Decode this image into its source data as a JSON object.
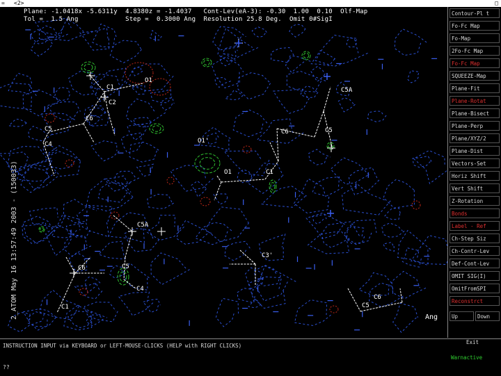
{
  "window": {
    "title_left": "=",
    "title": "<2>",
    "title_right": "□"
  },
  "header": {
    "line1": "Plane: -1.0418x -5.6311y  4.8380z = -1.4037   Cont-Lev(eA-3): -0.30  1.00  0.10  Olf-Map",
    "line2": "Tol =  1.5 Ang            Step =  0.3000 Ang  Resolution 25.8 Deg.  Omit 0#SigI"
  },
  "side_label": "2_ATOM  May 16 13:57:49 2003  -  (150033)",
  "axis_unit": "Ang",
  "colors": {
    "contour_blue": "#2a4fd0",
    "contour_green": "#30c030",
    "contour_red": "#c02818",
    "bond": "#ffffff"
  },
  "atoms": [
    {
      "label": "C1"
    },
    {
      "label": "O1"
    },
    {
      "label": "C2"
    },
    {
      "label": "C6"
    },
    {
      "label": "C5"
    },
    {
      "label": "C4"
    },
    {
      "label": "O1'"
    },
    {
      "label": "O1"
    },
    {
      "label": "C1"
    },
    {
      "label": "C6"
    },
    {
      "label": "C5"
    },
    {
      "label": "C5A"
    },
    {
      "label": "C5A"
    },
    {
      "label": "C6"
    },
    {
      "label": "C5"
    },
    {
      "label": "C4"
    },
    {
      "label": "C1"
    },
    {
      "label": "C3'"
    },
    {
      "label": "C6"
    },
    {
      "label": "C5"
    }
  ],
  "menu": {
    "items": [
      {
        "label": "Contour-Pl t",
        "color": "white"
      },
      {
        "label": "Fo-Fc Map",
        "color": "white"
      },
      {
        "label": "Fo-Map",
        "color": "white"
      },
      {
        "label": "2Fo-Fc Map",
        "color": "white"
      },
      {
        "label": "Fo-Fc Map",
        "color": "red"
      },
      {
        "label": "SQUEEZE-Map",
        "color": "white"
      },
      {
        "label": "Plane-Fit",
        "color": "white"
      },
      {
        "label": "Plane-Rotat",
        "color": "red"
      },
      {
        "label": "Plane-Bisect",
        "color": "white"
      },
      {
        "label": "Plane-Perp",
        "color": "white"
      },
      {
        "label": "Plane/XYZ/2",
        "color": "white"
      },
      {
        "label": "Plane-Dist",
        "color": "white"
      },
      {
        "label": "Vectors-Set",
        "color": "white"
      },
      {
        "label": "Horiz Shift",
        "color": "white"
      },
      {
        "label": "Vert  Shift",
        "color": "white"
      },
      {
        "label": "Z-Rotation",
        "color": "white"
      },
      {
        "label": "Bonds",
        "color": "red"
      },
      {
        "label": "Label - Ref",
        "color": "red"
      },
      {
        "label": "Ch-Step Siz",
        "color": "white"
      },
      {
        "label": "Ch-Contr-Lev",
        "color": "white"
      },
      {
        "label": "Def-Cont-Lev",
        "color": "white"
      },
      {
        "label": "OMIT SIG(I)",
        "color": "white"
      },
      {
        "label": "OmitFromSPI",
        "color": "white"
      },
      {
        "label": "Reconstrct",
        "color": "red"
      }
    ],
    "up_label": "Up",
    "down_label": "Down"
  },
  "bottom": {
    "instruction": "INSTRUCTION INPUT via KEYBOARD or LEFT-MOUSE-CLICKS (HELP with RIGHT CLICKS)",
    "prompt": "??",
    "exit_label": "Exit",
    "warn_label": "Warnactive"
  }
}
